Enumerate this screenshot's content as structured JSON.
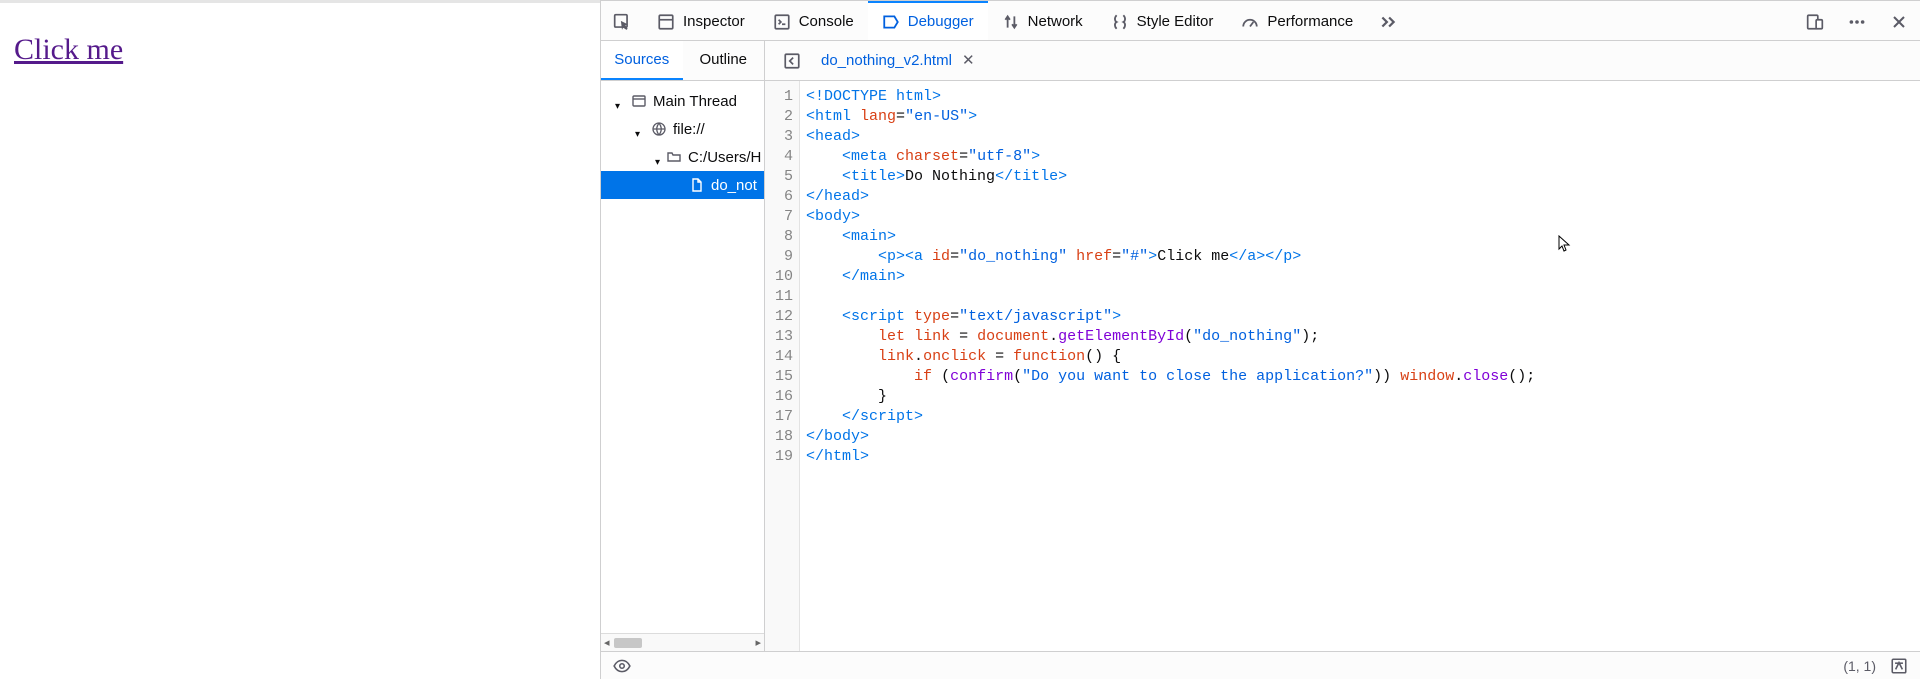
{
  "page": {
    "link_text": "Click me"
  },
  "toolbar": {
    "inspector": "Inspector",
    "console": "Console",
    "debugger": "Debugger",
    "network": "Network",
    "style_editor": "Style Editor",
    "performance": "Performance"
  },
  "subtabs": {
    "sources": "Sources",
    "outline": "Outline"
  },
  "file_tab": {
    "name": "do_nothing_v2.html"
  },
  "tree": {
    "main_thread": "Main Thread",
    "scheme": "file://",
    "folder": "C:/Users/H",
    "file": "do_not"
  },
  "code": {
    "lines": [
      [
        [
          "tag",
          "<!DOCTYPE html>"
        ]
      ],
      [
        [
          "tag",
          "<html "
        ],
        [
          "attr",
          "lang"
        ],
        [
          "txt",
          "="
        ],
        [
          "str",
          "\"en-US\""
        ],
        [
          "tag",
          ">"
        ]
      ],
      [
        [
          "tag",
          "<head>"
        ]
      ],
      [
        [
          "txt",
          "    "
        ],
        [
          "tag",
          "<meta "
        ],
        [
          "attr",
          "charset"
        ],
        [
          "txt",
          "="
        ],
        [
          "str",
          "\"utf-8\""
        ],
        [
          "tag",
          ">"
        ]
      ],
      [
        [
          "txt",
          "    "
        ],
        [
          "tag",
          "<title>"
        ],
        [
          "txt",
          "Do Nothing"
        ],
        [
          "tag",
          "</title>"
        ]
      ],
      [
        [
          "tag",
          "</head>"
        ]
      ],
      [
        [
          "tag",
          "<body>"
        ]
      ],
      [
        [
          "txt",
          "    "
        ],
        [
          "tag",
          "<main>"
        ]
      ],
      [
        [
          "txt",
          "        "
        ],
        [
          "tag",
          "<p><a "
        ],
        [
          "attr",
          "id"
        ],
        [
          "txt",
          "="
        ],
        [
          "str",
          "\"do_nothing\""
        ],
        [
          "txt",
          " "
        ],
        [
          "attr",
          "href"
        ],
        [
          "txt",
          "="
        ],
        [
          "str",
          "\"#\""
        ],
        [
          "tag",
          ">"
        ],
        [
          "txt",
          "Click me"
        ],
        [
          "tag",
          "</a></p>"
        ]
      ],
      [
        [
          "txt",
          "    "
        ],
        [
          "tag",
          "</main>"
        ]
      ],
      [
        [
          "txt",
          ""
        ]
      ],
      [
        [
          "txt",
          "    "
        ],
        [
          "tag",
          "<script "
        ],
        [
          "attr",
          "type"
        ],
        [
          "txt",
          "="
        ],
        [
          "str",
          "\"text/javascript\""
        ],
        [
          "tag",
          ">"
        ]
      ],
      [
        [
          "txt",
          "        "
        ],
        [
          "kw",
          "let"
        ],
        [
          "txt",
          " "
        ],
        [
          "attr",
          "link"
        ],
        [
          "txt",
          " = "
        ],
        [
          "attr",
          "document"
        ],
        [
          "txt",
          "."
        ],
        [
          "fn",
          "getElementById"
        ],
        [
          "txt",
          "("
        ],
        [
          "str",
          "\"do_nothing\""
        ],
        [
          "txt",
          ");"
        ]
      ],
      [
        [
          "txt",
          "        "
        ],
        [
          "attr",
          "link"
        ],
        [
          "txt",
          "."
        ],
        [
          "attr",
          "onclick"
        ],
        [
          "txt",
          " = "
        ],
        [
          "kw",
          "function"
        ],
        [
          "txt",
          "() {"
        ]
      ],
      [
        [
          "txt",
          "            "
        ],
        [
          "kw",
          "if"
        ],
        [
          "txt",
          " ("
        ],
        [
          "fn",
          "confirm"
        ],
        [
          "txt",
          "("
        ],
        [
          "str",
          "\"Do you want to close the application?\""
        ],
        [
          "txt",
          ")) "
        ],
        [
          "attr",
          "window"
        ],
        [
          "txt",
          "."
        ],
        [
          "fn",
          "close"
        ],
        [
          "txt",
          "();"
        ]
      ],
      [
        [
          "txt",
          "        }"
        ]
      ],
      [
        [
          "txt",
          "    "
        ],
        [
          "tag",
          "</scr"
        ],
        [
          "tag",
          "ipt>"
        ]
      ],
      [
        [
          "tag",
          "</body>"
        ]
      ],
      [
        [
          "tag",
          "</html>"
        ]
      ]
    ]
  },
  "status": {
    "cursor": "(1, 1)"
  }
}
